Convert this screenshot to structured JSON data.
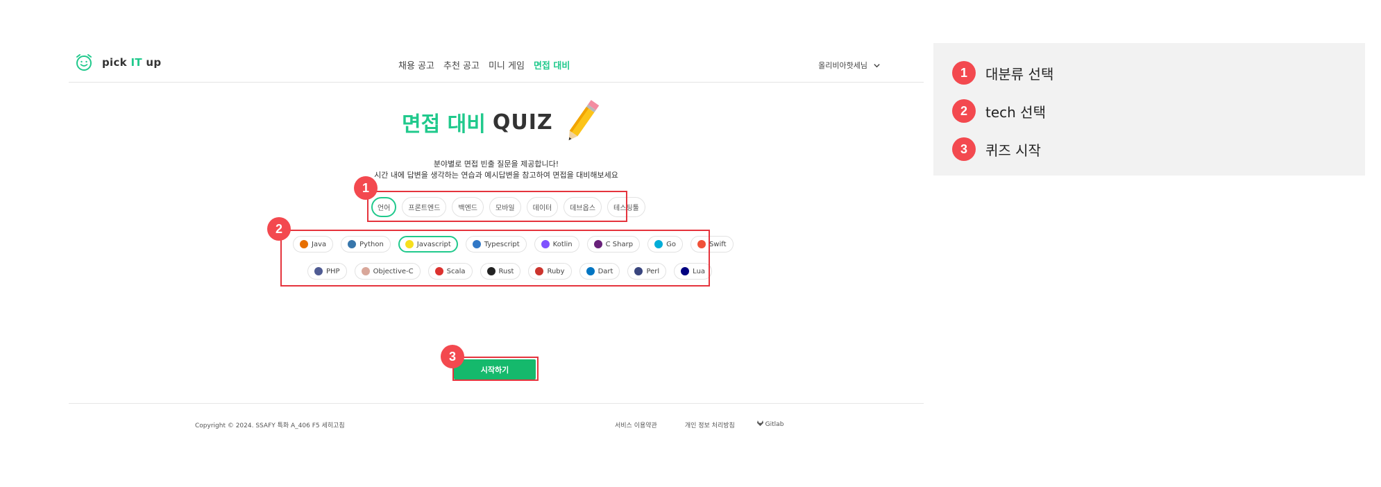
{
  "header": {
    "logo_text_pre": "pick ",
    "logo_text_it": "IT",
    "logo_text_post": " up",
    "nav": [
      "채용 공고",
      "추천 공고",
      "미니 게임",
      "면접 대비"
    ],
    "active_nav_index": 3,
    "user_label": "올리비아핫세님"
  },
  "hero": {
    "title_kr": "면접 대비",
    "title_en": "QUIZ",
    "desc_line1": "분야별로 면접 빈출 질문을 제공합니다!",
    "desc_line2": "시간 내에 답변을 생각하는 연습과 예시답변을 참고하여 면접을 대비해보세요"
  },
  "categories": {
    "items": [
      "언어",
      "프론트엔드",
      "백엔드",
      "모바일",
      "데이터",
      "데브옵스",
      "테스팅툴"
    ],
    "selected_index": 0
  },
  "techs": {
    "row1": [
      {
        "label": "Java",
        "icon": "java-icon",
        "color": "#e76f00"
      },
      {
        "label": "Python",
        "icon": "python-icon",
        "color": "#3776ab"
      },
      {
        "label": "Javascript",
        "icon": "javascript-icon",
        "color": "#f7df1e",
        "selected": true
      },
      {
        "label": "Typescript",
        "icon": "typescript-icon",
        "color": "#3178c6"
      },
      {
        "label": "Kotlin",
        "icon": "kotlin-icon",
        "color": "#7f52ff"
      },
      {
        "label": "C Sharp",
        "icon": "csharp-icon",
        "color": "#68217a"
      },
      {
        "label": "Go",
        "icon": "go-icon",
        "color": "#00add8"
      },
      {
        "label": "Swift",
        "icon": "swift-icon",
        "color": "#f05138"
      }
    ],
    "row2": [
      {
        "label": "PHP",
        "icon": "php-icon",
        "color": "#4f5b93"
      },
      {
        "label": "Objective-C",
        "icon": "objective-c-icon",
        "color": "#d9a79a"
      },
      {
        "label": "Scala",
        "icon": "scala-icon",
        "color": "#dc322f"
      },
      {
        "label": "Rust",
        "icon": "rust-icon",
        "color": "#222222"
      },
      {
        "label": "Ruby",
        "icon": "ruby-icon",
        "color": "#cc342d"
      },
      {
        "label": "Dart",
        "icon": "dart-icon",
        "color": "#0175c2"
      },
      {
        "label": "Perl",
        "icon": "perl-icon",
        "color": "#39457e"
      },
      {
        "label": "Lua",
        "icon": "lua-icon",
        "color": "#000080"
      }
    ]
  },
  "start_button_label": "시작하기",
  "footer": {
    "copyright": "Copyright © 2024. SSAFY 특화 A_406 F5 세히고침",
    "terms": "서비스 이용약관",
    "privacy": "개인 정보 처리방침",
    "gitlab": "Gitlab"
  },
  "annotations": {
    "badges": [
      "1",
      "2",
      "3"
    ],
    "legend": [
      {
        "num": "1",
        "label": "대분류 선택"
      },
      {
        "num": "2",
        "label": "tech 선택"
      },
      {
        "num": "3",
        "label": "퀴즈 시작"
      }
    ],
    "colors": {
      "accent": "#20c98c",
      "button": "#15b96c",
      "annotation": "#f3494f"
    }
  }
}
